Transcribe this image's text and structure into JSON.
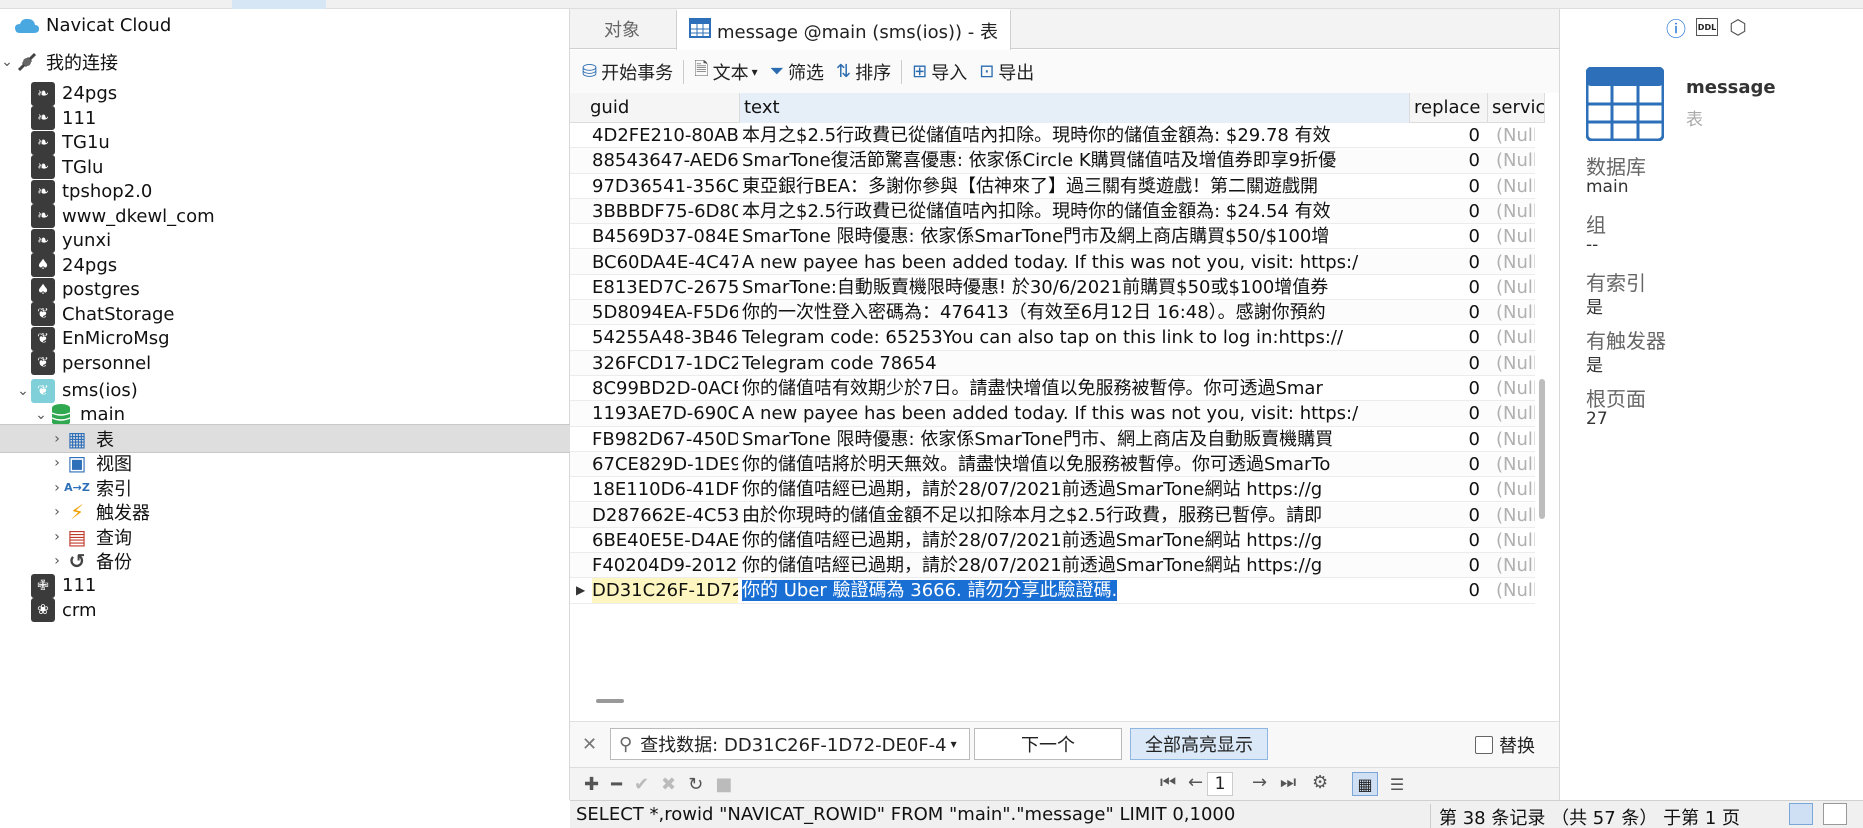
{
  "sidebar": {
    "cloud_label": "Navicat Cloud",
    "my_connections": "我的连接",
    "connections": [
      {
        "label": "24pgs",
        "icon": "mysql-icon"
      },
      {
        "label": "111",
        "icon": "mysql-icon"
      },
      {
        "label": "TG1u",
        "icon": "mysql-icon"
      },
      {
        "label": "TGlu",
        "icon": "mysql-icon"
      },
      {
        "label": "tpshop2.0",
        "icon": "mysql-icon"
      },
      {
        "label": "www_dkewl_com",
        "icon": "mysql-icon"
      },
      {
        "label": "yunxi",
        "icon": "mysql-icon"
      },
      {
        "label": "24pgs",
        "icon": "postgres-icon"
      },
      {
        "label": "postgres",
        "icon": "postgres-icon"
      },
      {
        "label": "ChatStorage",
        "icon": "sqlite-icon"
      },
      {
        "label": "EnMicroMsg",
        "icon": "sqlite-icon"
      },
      {
        "label": "personnel",
        "icon": "sqlite-icon"
      }
    ],
    "open_connection": "sms(ios)",
    "database": "main",
    "db_children": [
      {
        "label": "表",
        "icon": "table-icon"
      },
      {
        "label": "视图",
        "icon": "view-icon"
      },
      {
        "label": "索引",
        "icon": "index-icon"
      },
      {
        "label": "触发器",
        "icon": "trigger-icon"
      },
      {
        "label": "查询",
        "icon": "query-icon"
      },
      {
        "label": "备份",
        "icon": "backup-icon"
      }
    ],
    "after": [
      {
        "label": "111",
        "icon": "sqlserver-icon"
      },
      {
        "label": "crm",
        "icon": "mongodb-icon"
      }
    ]
  },
  "tabs": {
    "objects": "对象",
    "active": "message @main (sms(ios)) - 表"
  },
  "toolbar": {
    "begin_tx": "开始事务",
    "text": "文本",
    "filter": "筛选",
    "sort": "排序",
    "import": "导入",
    "export": "导出"
  },
  "grid": {
    "columns": [
      "guid",
      "text",
      "replace",
      "service_center"
    ],
    "rows": [
      {
        "guid": "4D2FE210-80AB-",
        "text": "本月之$2.5行政費已從儲值咭內扣除。現時你的儲值金額為: $29.78 有效",
        "replace": "0",
        "svc": "(Null)"
      },
      {
        "guid": "88543647-AED6-",
        "text": "SmarTone復活節驚喜優惠: 依家係Circle K購買儲值咭及增值券即享9折優",
        "replace": "0",
        "svc": "(Null)"
      },
      {
        "guid": "97D36541-356C-",
        "text": "東亞銀行BEA：多謝你參與【估神來了】過三關有獎遊戲！第二關遊戲開",
        "replace": "0",
        "svc": "(Null)"
      },
      {
        "guid": "3BBBDF75-6D80-",
        "text": "本月之$2.5行政費已從儲值咭內扣除。現時你的儲值金額為: $24.54 有效",
        "replace": "0",
        "svc": "(Null)"
      },
      {
        "guid": "B4569D37-084E-",
        "text": "SmarTone 限時優惠: 依家係SmarTone門市及網上商店購買$50/$100增",
        "replace": "0",
        "svc": "(Null)"
      },
      {
        "guid": "BC60DA4E-4C47",
        "text": "A new payee has been added today. If this was not you, visit: https:/",
        "replace": "0",
        "svc": "(Null)"
      },
      {
        "guid": "E813ED7C-2675-",
        "text": "SmarTone:自動販賣機限時優惠! 於30/6/2021前購買$50或$100增值券",
        "replace": "0",
        "svc": "(Null)"
      },
      {
        "guid": "5D8094EA-F5D6",
        "text": "你的一次性登入密碼為：476413（有效至6月12日 16:48）。感謝你預約",
        "replace": "0",
        "svc": "(Null)"
      },
      {
        "guid": "54255A48-3B46-",
        "text": "Telegram code: 65253You can also tap on this link to log in:https://",
        "replace": "0",
        "svc": "(Null)"
      },
      {
        "guid": "326FCD17-1DC2",
        "text": "Telegram code 78654",
        "replace": "0",
        "svc": "(Null)"
      },
      {
        "guid": "8C99BD2D-0ACB",
        "text": "你的儲值咭有效期少於7日。請盡快增值以免服務被暫停。你可透過Smar",
        "replace": "0",
        "svc": "(Null)"
      },
      {
        "guid": "1193AE7D-690C-",
        "text": "A new payee has been added today. If this was not you, visit: https:/",
        "replace": "0",
        "svc": "(Null)"
      },
      {
        "guid": "FB982D67-450D-",
        "text": "SmarTone 限時優惠: 依家係SmarTone門市、網上商店及自動販賣機購買",
        "replace": "0",
        "svc": "(Null)"
      },
      {
        "guid": "67CE829D-1DE9-",
        "text": "你的儲值咭將於明天無效。請盡快增值以免服務被暫停。你可透過SmarTo",
        "replace": "0",
        "svc": "(Null)"
      },
      {
        "guid": "18E110D6-41DF-",
        "text": "你的儲值咭經已過期，請於28/07/2021前透過SmarTone網站 https://g",
        "replace": "0",
        "svc": "(Null)"
      },
      {
        "guid": "D287662E-4C53-",
        "text": "由於你現時的儲值金額不足以扣除本月之$2.5行政費，服務已暫停。請即",
        "replace": "0",
        "svc": "(Null)"
      },
      {
        "guid": "6BE40E5E-D4AE-",
        "text": "你的儲值咭經已過期，請於28/07/2021前透過SmarTone網站 https://g",
        "replace": "0",
        "svc": "(Null)"
      },
      {
        "guid": "F40204D9-2012-",
        "text": "你的儲值咭經已過期，請於28/07/2021前透過SmarTone網站 https://g",
        "replace": "0",
        "svc": "(Null)"
      },
      {
        "guid": "DD31C26F-1D72",
        "text": "你的 Uber 驗證碼為 3666. 請勿分享此驗證碼.",
        "replace": "0",
        "svc": "(Null)"
      }
    ]
  },
  "find": {
    "value": "查找数据: DD31C26F-1D72-DE0F-4",
    "next": "下一个",
    "highlight_all": "全部高亮显示",
    "replace": "替换"
  },
  "nav": {
    "page": "1"
  },
  "right_panel": {
    "name": "message",
    "type": "表",
    "db_label": "数据库",
    "db_value": "main",
    "group_label": "组",
    "group_value": "--",
    "has_index_label": "有索引",
    "has_index_value": "是",
    "has_trigger_label": "有触发器",
    "has_trigger_value": "是",
    "root_page_label": "根页面",
    "root_page_value": "27"
  },
  "status": {
    "sql": "SELECT *,rowid \"NAVICAT_ROWID\" FROM \"main\".\"message\" LIMIT 0,1000",
    "records": "第 38 条记录 （共 57 条） 于第 1 页"
  },
  "colors": {
    "accent": "#1a6fd4",
    "selection_bg": "#dedede",
    "null_text": "#b0b0b0"
  }
}
